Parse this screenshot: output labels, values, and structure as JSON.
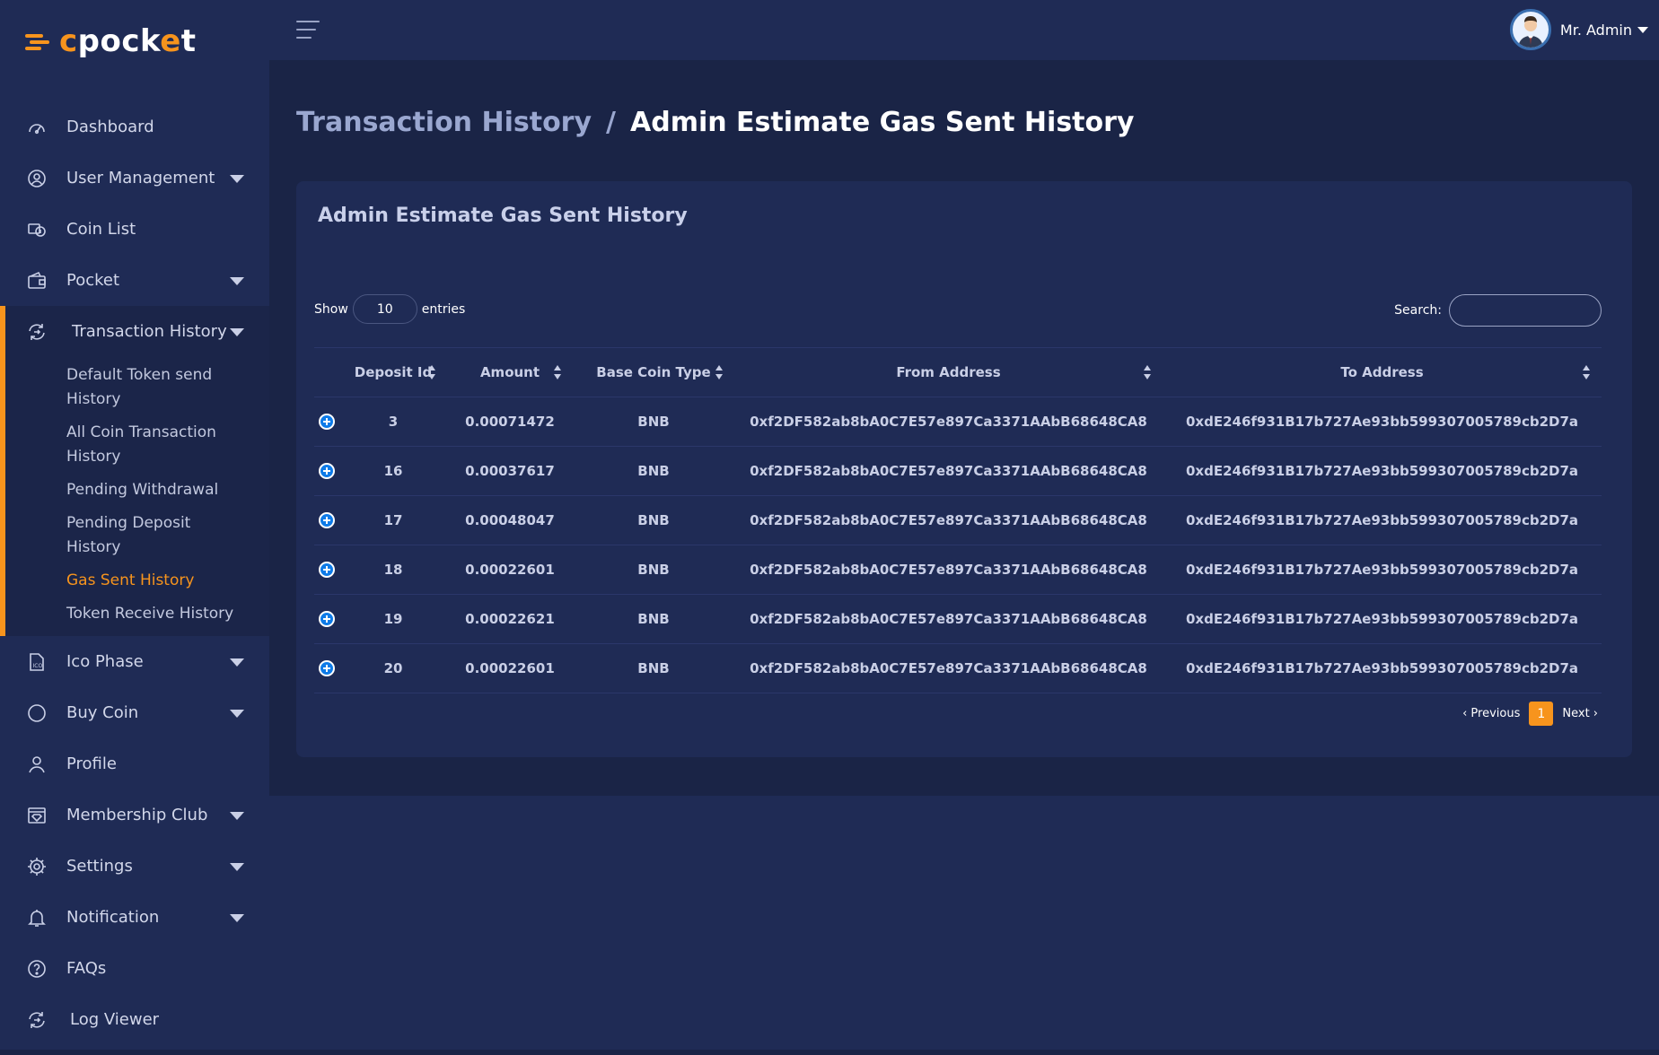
{
  "brand": {
    "logo_text_c": "c",
    "logo_text_rest": "pock",
    "logo_text_e": "e",
    "logo_text_t": "t"
  },
  "sidebar": {
    "items": [
      {
        "label": "Dashboard",
        "icon": "speedometer-icon"
      },
      {
        "label": "User Management",
        "icon": "user-circle-icon",
        "has_caret": true
      },
      {
        "label": "Coin List",
        "icon": "coins-icon"
      },
      {
        "label": "Pocket",
        "icon": "wallet-icon",
        "has_caret": true
      },
      {
        "label": "Transaction History",
        "icon": "exchange-icon",
        "has_caret": true,
        "active": true
      },
      {
        "label": "Ico Phase",
        "icon": "ico-document-icon",
        "has_caret": true
      },
      {
        "label": "Buy Coin",
        "icon": "circle-icon",
        "has_caret": true
      },
      {
        "label": "Profile",
        "icon": "user-icon"
      },
      {
        "label": "Membership Club",
        "icon": "diamond-card-icon",
        "has_caret": true
      },
      {
        "label": "Settings",
        "icon": "gear-icon",
        "has_caret": true
      },
      {
        "label": "Notification",
        "icon": "bell-icon",
        "has_caret": true
      },
      {
        "label": "FAQs",
        "icon": "question-icon"
      },
      {
        "label": "Log Viewer",
        "icon": "exchange-icon"
      }
    ],
    "transaction_sub": [
      "Default Token send History",
      "All Coin Transaction History",
      "Pending Withdrawal",
      "Pending Deposit History",
      "Gas Sent History",
      "Token Receive History"
    ],
    "current_sub": "Gas Sent History"
  },
  "topbar": {
    "user_name": "Mr. Admin"
  },
  "breadcrumb": {
    "parent": "Transaction History",
    "separator": "/",
    "current": "Admin Estimate Gas Sent History"
  },
  "card": {
    "title": "Admin Estimate Gas Sent History",
    "show_label": "Show",
    "entries_value": "10",
    "entries_label": "entries",
    "search_label": "Search:",
    "search_value": ""
  },
  "table": {
    "columns": [
      "Deposit Id",
      "Amount",
      "Base Coin Type",
      "From Address",
      "To Address"
    ],
    "rows": [
      {
        "deposit_id": "3",
        "amount": "0.00071472",
        "base_coin_type": "BNB",
        "from": "0xf2DF582ab8bA0C7E57e897Ca3371AAbB68648CA8",
        "to": "0xdE246f931B17b727Ae93bb599307005789cb2D7a"
      },
      {
        "deposit_id": "16",
        "amount": "0.00037617",
        "base_coin_type": "BNB",
        "from": "0xf2DF582ab8bA0C7E57e897Ca3371AAbB68648CA8",
        "to": "0xdE246f931B17b727Ae93bb599307005789cb2D7a"
      },
      {
        "deposit_id": "17",
        "amount": "0.00048047",
        "base_coin_type": "BNB",
        "from": "0xf2DF582ab8bA0C7E57e897Ca3371AAbB68648CA8",
        "to": "0xdE246f931B17b727Ae93bb599307005789cb2D7a"
      },
      {
        "deposit_id": "18",
        "amount": "0.00022601",
        "base_coin_type": "BNB",
        "from": "0xf2DF582ab8bA0C7E57e897Ca3371AAbB68648CA8",
        "to": "0xdE246f931B17b727Ae93bb599307005789cb2D7a"
      },
      {
        "deposit_id": "19",
        "amount": "0.00022621",
        "base_coin_type": "BNB",
        "from": "0xf2DF582ab8bA0C7E57e897Ca3371AAbB68648CA8",
        "to": "0xdE246f931B17b727Ae93bb599307005789cb2D7a"
      },
      {
        "deposit_id": "20",
        "amount": "0.00022601",
        "base_coin_type": "BNB",
        "from": "0xf2DF582ab8bA0C7E57e897Ca3371AAbB68648CA8",
        "to": "0xdE246f931B17b727Ae93bb599307005789cb2D7a"
      }
    ]
  },
  "pagination": {
    "previous": "‹ Previous",
    "current_page": "1",
    "next": "Next ›"
  },
  "colors": {
    "accent": "#f7941d",
    "sidebar_bg": "#1f2b55",
    "main_bg": "#1a2446",
    "expand_button": "#0e7be8"
  }
}
